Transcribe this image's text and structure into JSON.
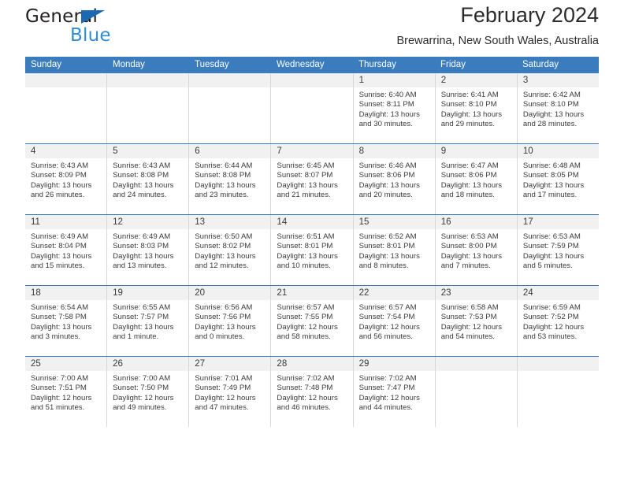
{
  "brand": {
    "name_part1": "General",
    "name_part2": "Blue"
  },
  "header": {
    "title": "February 2024",
    "subtitle": "Brewarrina, New South Wales, Australia"
  },
  "colors": {
    "header_blue": "#3a7cbe",
    "brand_dark": "#231f20",
    "brand_blue": "#2e8bd4",
    "daynum_band": "#f1f1f1",
    "cell_border": "#d8d8d8"
  },
  "weekdays": [
    "Sunday",
    "Monday",
    "Tuesday",
    "Wednesday",
    "Thursday",
    "Friday",
    "Saturday"
  ],
  "weeks": [
    [
      {
        "day": "",
        "sunrise": "",
        "sunset": "",
        "daylight": "",
        "empty": true
      },
      {
        "day": "",
        "sunrise": "",
        "sunset": "",
        "daylight": "",
        "empty": true
      },
      {
        "day": "",
        "sunrise": "",
        "sunset": "",
        "daylight": "",
        "empty": true
      },
      {
        "day": "",
        "sunrise": "",
        "sunset": "",
        "daylight": "",
        "empty": true
      },
      {
        "day": "1",
        "sunrise": "Sunrise: 6:40 AM",
        "sunset": "Sunset: 8:11 PM",
        "daylight": "Daylight: 13 hours and 30 minutes."
      },
      {
        "day": "2",
        "sunrise": "Sunrise: 6:41 AM",
        "sunset": "Sunset: 8:10 PM",
        "daylight": "Daylight: 13 hours and 29 minutes."
      },
      {
        "day": "3",
        "sunrise": "Sunrise: 6:42 AM",
        "sunset": "Sunset: 8:10 PM",
        "daylight": "Daylight: 13 hours and 28 minutes."
      }
    ],
    [
      {
        "day": "4",
        "sunrise": "Sunrise: 6:43 AM",
        "sunset": "Sunset: 8:09 PM",
        "daylight": "Daylight: 13 hours and 26 minutes."
      },
      {
        "day": "5",
        "sunrise": "Sunrise: 6:43 AM",
        "sunset": "Sunset: 8:08 PM",
        "daylight": "Daylight: 13 hours and 24 minutes."
      },
      {
        "day": "6",
        "sunrise": "Sunrise: 6:44 AM",
        "sunset": "Sunset: 8:08 PM",
        "daylight": "Daylight: 13 hours and 23 minutes."
      },
      {
        "day": "7",
        "sunrise": "Sunrise: 6:45 AM",
        "sunset": "Sunset: 8:07 PM",
        "daylight": "Daylight: 13 hours and 21 minutes."
      },
      {
        "day": "8",
        "sunrise": "Sunrise: 6:46 AM",
        "sunset": "Sunset: 8:06 PM",
        "daylight": "Daylight: 13 hours and 20 minutes."
      },
      {
        "day": "9",
        "sunrise": "Sunrise: 6:47 AM",
        "sunset": "Sunset: 8:06 PM",
        "daylight": "Daylight: 13 hours and 18 minutes."
      },
      {
        "day": "10",
        "sunrise": "Sunrise: 6:48 AM",
        "sunset": "Sunset: 8:05 PM",
        "daylight": "Daylight: 13 hours and 17 minutes."
      }
    ],
    [
      {
        "day": "11",
        "sunrise": "Sunrise: 6:49 AM",
        "sunset": "Sunset: 8:04 PM",
        "daylight": "Daylight: 13 hours and 15 minutes."
      },
      {
        "day": "12",
        "sunrise": "Sunrise: 6:49 AM",
        "sunset": "Sunset: 8:03 PM",
        "daylight": "Daylight: 13 hours and 13 minutes."
      },
      {
        "day": "13",
        "sunrise": "Sunrise: 6:50 AM",
        "sunset": "Sunset: 8:02 PM",
        "daylight": "Daylight: 13 hours and 12 minutes."
      },
      {
        "day": "14",
        "sunrise": "Sunrise: 6:51 AM",
        "sunset": "Sunset: 8:01 PM",
        "daylight": "Daylight: 13 hours and 10 minutes."
      },
      {
        "day": "15",
        "sunrise": "Sunrise: 6:52 AM",
        "sunset": "Sunset: 8:01 PM",
        "daylight": "Daylight: 13 hours and 8 minutes."
      },
      {
        "day": "16",
        "sunrise": "Sunrise: 6:53 AM",
        "sunset": "Sunset: 8:00 PM",
        "daylight": "Daylight: 13 hours and 7 minutes."
      },
      {
        "day": "17",
        "sunrise": "Sunrise: 6:53 AM",
        "sunset": "Sunset: 7:59 PM",
        "daylight": "Daylight: 13 hours and 5 minutes."
      }
    ],
    [
      {
        "day": "18",
        "sunrise": "Sunrise: 6:54 AM",
        "sunset": "Sunset: 7:58 PM",
        "daylight": "Daylight: 13 hours and 3 minutes."
      },
      {
        "day": "19",
        "sunrise": "Sunrise: 6:55 AM",
        "sunset": "Sunset: 7:57 PM",
        "daylight": "Daylight: 13 hours and 1 minute."
      },
      {
        "day": "20",
        "sunrise": "Sunrise: 6:56 AM",
        "sunset": "Sunset: 7:56 PM",
        "daylight": "Daylight: 13 hours and 0 minutes."
      },
      {
        "day": "21",
        "sunrise": "Sunrise: 6:57 AM",
        "sunset": "Sunset: 7:55 PM",
        "daylight": "Daylight: 12 hours and 58 minutes."
      },
      {
        "day": "22",
        "sunrise": "Sunrise: 6:57 AM",
        "sunset": "Sunset: 7:54 PM",
        "daylight": "Daylight: 12 hours and 56 minutes."
      },
      {
        "day": "23",
        "sunrise": "Sunrise: 6:58 AM",
        "sunset": "Sunset: 7:53 PM",
        "daylight": "Daylight: 12 hours and 54 minutes."
      },
      {
        "day": "24",
        "sunrise": "Sunrise: 6:59 AM",
        "sunset": "Sunset: 7:52 PM",
        "daylight": "Daylight: 12 hours and 53 minutes."
      }
    ],
    [
      {
        "day": "25",
        "sunrise": "Sunrise: 7:00 AM",
        "sunset": "Sunset: 7:51 PM",
        "daylight": "Daylight: 12 hours and 51 minutes."
      },
      {
        "day": "26",
        "sunrise": "Sunrise: 7:00 AM",
        "sunset": "Sunset: 7:50 PM",
        "daylight": "Daylight: 12 hours and 49 minutes."
      },
      {
        "day": "27",
        "sunrise": "Sunrise: 7:01 AM",
        "sunset": "Sunset: 7:49 PM",
        "daylight": "Daylight: 12 hours and 47 minutes."
      },
      {
        "day": "28",
        "sunrise": "Sunrise: 7:02 AM",
        "sunset": "Sunset: 7:48 PM",
        "daylight": "Daylight: 12 hours and 46 minutes."
      },
      {
        "day": "29",
        "sunrise": "Sunrise: 7:02 AM",
        "sunset": "Sunset: 7:47 PM",
        "daylight": "Daylight: 12 hours and 44 minutes."
      },
      {
        "day": "",
        "sunrise": "",
        "sunset": "",
        "daylight": "",
        "empty": true
      },
      {
        "day": "",
        "sunrise": "",
        "sunset": "",
        "daylight": "",
        "empty": true
      }
    ]
  ]
}
